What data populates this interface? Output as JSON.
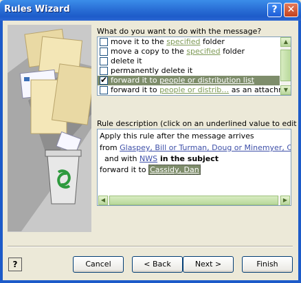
{
  "window": {
    "title": "Rules Wizard",
    "help_glyph": "?",
    "close_glyph": "✕"
  },
  "question": "What do you want to do with the message?",
  "actions": [
    {
      "checked": false,
      "pre": "move it to the ",
      "link": "specified",
      "post": " folder",
      "selected": false
    },
    {
      "checked": false,
      "pre": "move a copy to the ",
      "link": "specified",
      "post": " folder",
      "selected": false
    },
    {
      "checked": false,
      "pre": "delete it",
      "link": "",
      "post": "",
      "selected": false
    },
    {
      "checked": false,
      "pre": "permanently delete it",
      "link": "",
      "post": "",
      "selected": false
    },
    {
      "checked": true,
      "pre": "forward it to ",
      "link": "people or distribution list",
      "post": "",
      "selected": true
    },
    {
      "checked": false,
      "pre": "forward it to ",
      "link": "people or distrib…",
      "post": "   as an attachment",
      "selected": false
    }
  ],
  "description_label": "Rule description (click on an underlined value to edit it):",
  "description": {
    "line1": "Apply this rule after the message arrives",
    "line2_pre": "from ",
    "line2_link": "Glaspey, Bill or Turman, Doug or Minemyer, Calvin or",
    "line3_pre": "  and with ",
    "line3_link": "NWS",
    "line3_post": " in the subject",
    "line4_pre": "forward it to ",
    "line4_link": "Cassidy, Dan"
  },
  "buttons": {
    "cancel": "Cancel",
    "back": "< Back",
    "next": "Next >",
    "finish": "Finish",
    "help": "?"
  },
  "colors": {
    "title_bar": "#2A6FD6",
    "selection": "#7E8D6B",
    "link_green": "#7E9A56",
    "link_blue": "#3D4FA8",
    "dialog_bg": "#ECE9D8"
  }
}
